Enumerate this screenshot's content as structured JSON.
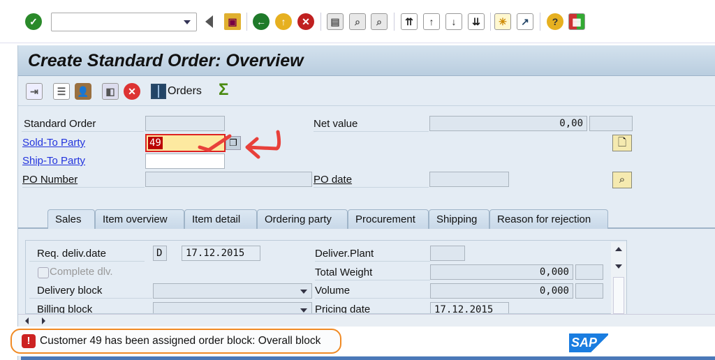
{
  "system_toolbar": {
    "command_field": {
      "value": "",
      "placeholder": ""
    },
    "icons": [
      "enter-icon",
      "back-triangle-icon",
      "save-icon",
      "back-icon",
      "exit-icon",
      "cancel-icon",
      "print-icon",
      "find-icon",
      "find-next-icon",
      "first-page-icon",
      "previous-page-icon",
      "next-page-icon",
      "last-page-icon",
      "new-session-icon",
      "shortcut-icon",
      "help-icon",
      "layout-icon"
    ]
  },
  "title": "Create Standard Order: Overview",
  "app_toolbar": {
    "orders_label": "Orders"
  },
  "header": {
    "standard_order": {
      "label": "Standard Order",
      "value": ""
    },
    "sold_to": {
      "label": "Sold-To Party",
      "value": "49"
    },
    "ship_to": {
      "label": "Ship-To Party",
      "value": ""
    },
    "po_number": {
      "label": "PO Number",
      "value": ""
    },
    "net_value": {
      "label": "Net value",
      "value": "0,00",
      "currency": ""
    },
    "po_date": {
      "label": "PO date",
      "value": ""
    }
  },
  "tabs": [
    "Sales",
    "Item overview",
    "Item detail",
    "Ordering party",
    "Procurement",
    "Shipping",
    "Reason for rejection"
  ],
  "sales": {
    "req_deliv_date": {
      "label": "Req. deliv.date",
      "format": "D",
      "value": "17.12.2015"
    },
    "complete_dlv": {
      "label": "Complete dlv.",
      "checked": false
    },
    "delivery_block": {
      "label": "Delivery block",
      "value": ""
    },
    "billing_block": {
      "label": "Billing block",
      "value": ""
    },
    "deliver_plant": {
      "label": "Deliver.Plant",
      "value": ""
    },
    "total_weight": {
      "label": "Total Weight",
      "value": "0,000",
      "unit": ""
    },
    "volume": {
      "label": "Volume",
      "value": "0,000",
      "unit": ""
    },
    "pricing_date": {
      "label": "Pricing date",
      "value": "17.12.2015"
    }
  },
  "status": {
    "message": "Customer 49 has been assigned order block: Overall block",
    "type": "error"
  },
  "logo": "SAP",
  "colors": {
    "accent_orange": "#f08a24",
    "error_red": "#cc2222",
    "annotation_red": "#e8403a",
    "link": "#2233dd"
  }
}
